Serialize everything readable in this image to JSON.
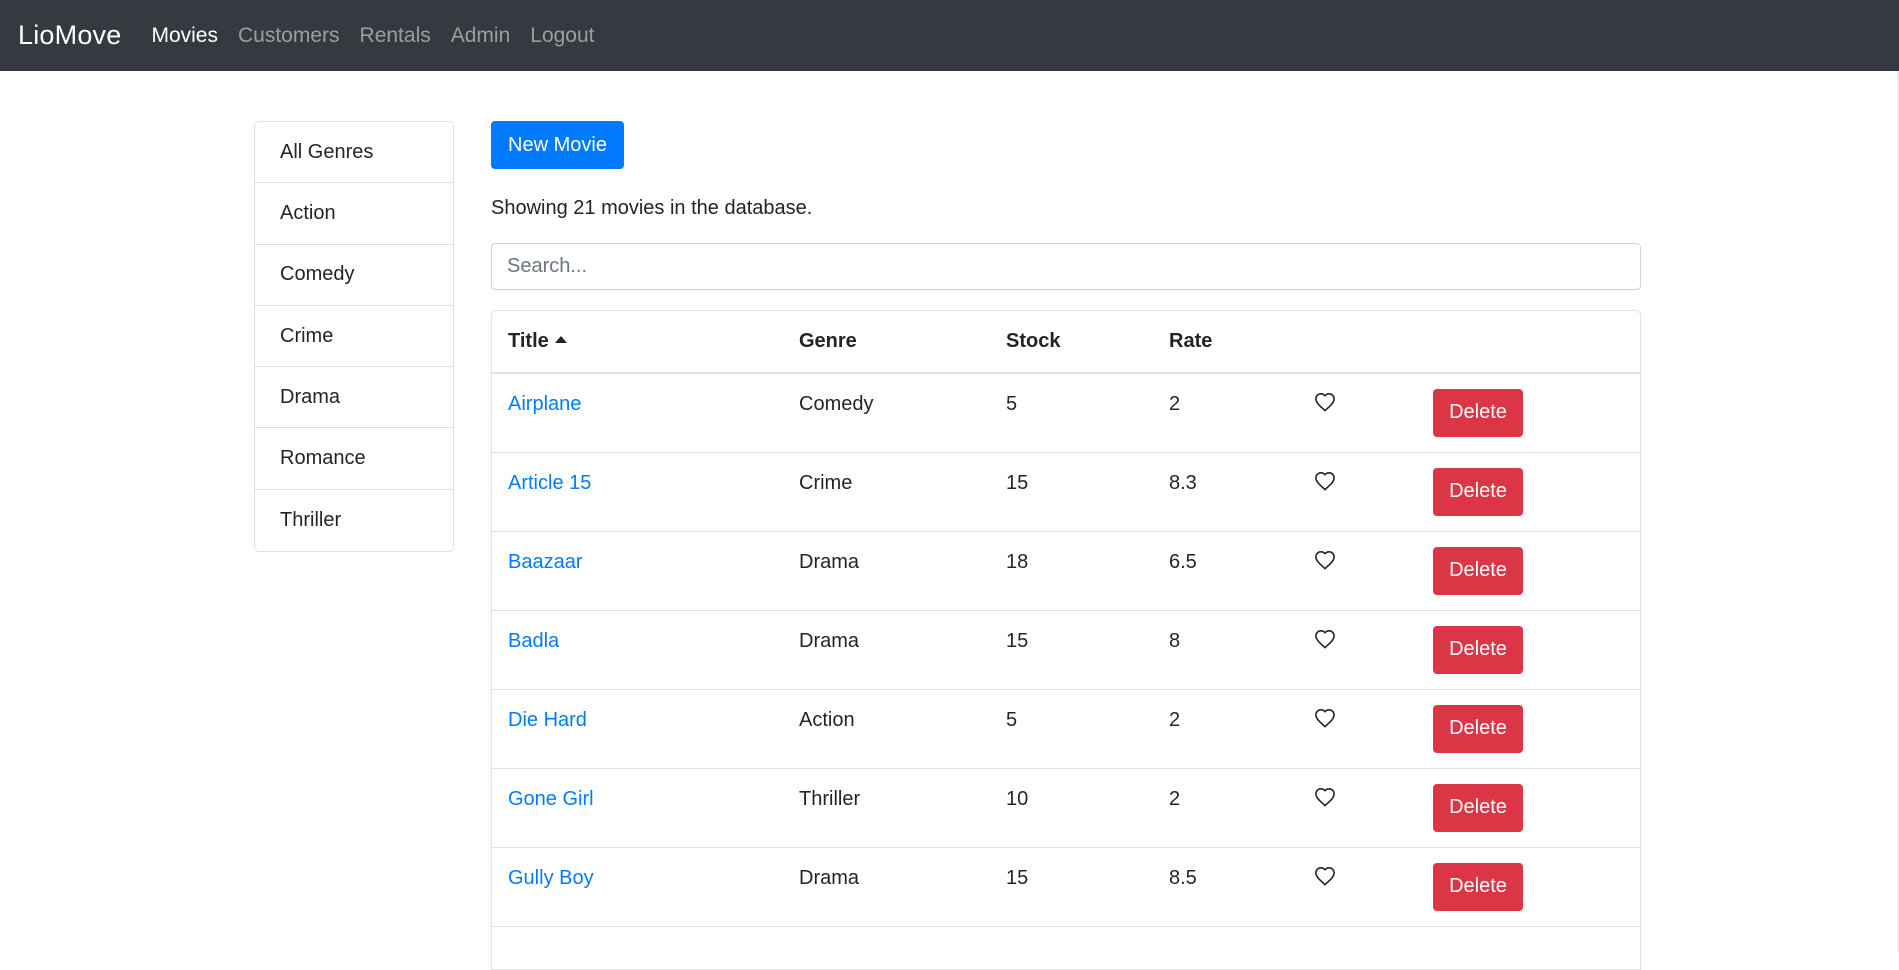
{
  "navbar": {
    "brand": "LioMove",
    "links": [
      {
        "label": "Movies",
        "active": true
      },
      {
        "label": "Customers",
        "active": false
      },
      {
        "label": "Rentals",
        "active": false
      },
      {
        "label": "Admin",
        "active": false
      },
      {
        "label": "Logout",
        "active": false
      }
    ]
  },
  "genres": [
    "All Genres",
    "Action",
    "Comedy",
    "Crime",
    "Drama",
    "Romance",
    "Thriller"
  ],
  "main": {
    "new_movie_label": "New Movie",
    "showing_text": "Showing 21 movies in the database.",
    "search_placeholder": "Search...",
    "search_value": ""
  },
  "table": {
    "headers": {
      "title": "Title",
      "genre": "Genre",
      "stock": "Stock",
      "rate": "Rate"
    },
    "sort": {
      "column": "title",
      "direction": "asc"
    },
    "like_icon": "heart-outline-icon",
    "delete_label": "Delete",
    "rows": [
      {
        "title": "Airplane",
        "genre": "Comedy",
        "stock": "5",
        "rate": "2"
      },
      {
        "title": "Article 15",
        "genre": "Crime",
        "stock": "15",
        "rate": "8.3"
      },
      {
        "title": "Baazaar",
        "genre": "Drama",
        "stock": "18",
        "rate": "6.5"
      },
      {
        "title": "Badla",
        "genre": "Drama",
        "stock": "15",
        "rate": "8"
      },
      {
        "title": "Die Hard",
        "genre": "Action",
        "stock": "5",
        "rate": "2"
      },
      {
        "title": "Gone Girl",
        "genre": "Thriller",
        "stock": "10",
        "rate": "2"
      },
      {
        "title": "Gully Boy",
        "genre": "Drama",
        "stock": "15",
        "rate": "8.5"
      }
    ]
  },
  "colors": {
    "navbar_bg": "#343a40",
    "primary": "#007bff",
    "danger": "#dc3545"
  }
}
